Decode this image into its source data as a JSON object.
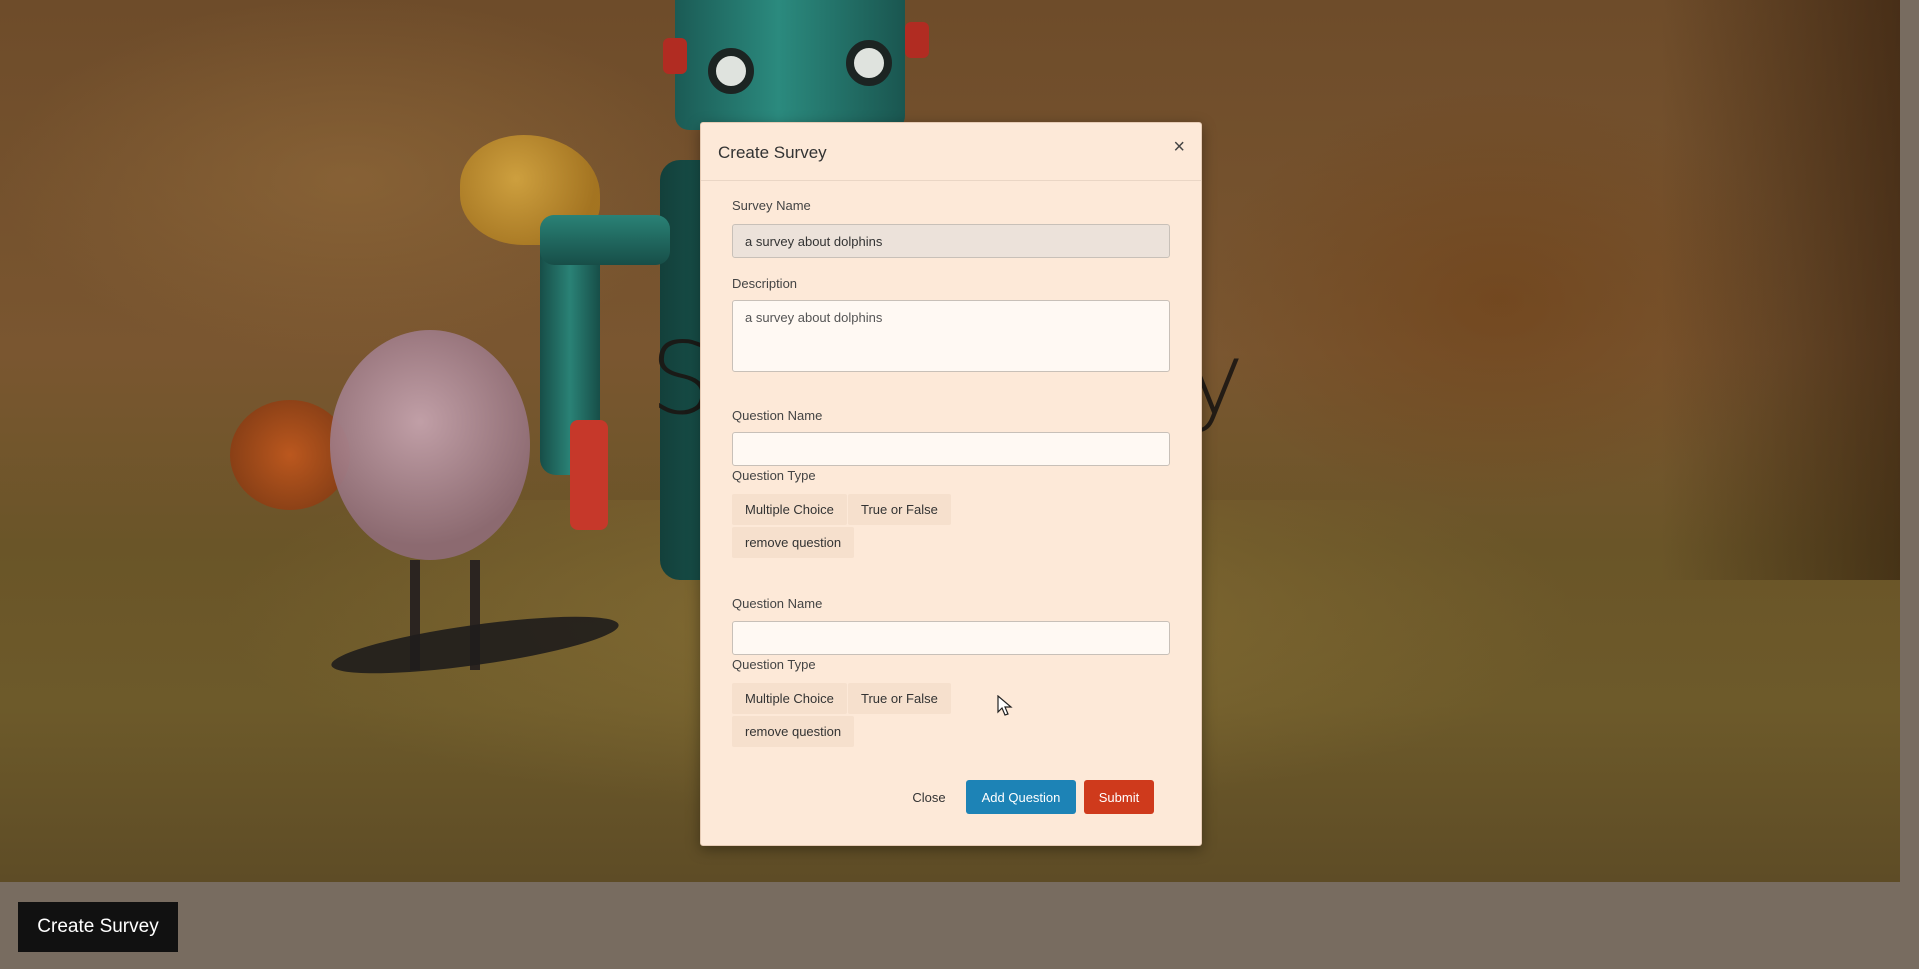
{
  "background": {
    "title_left": "S",
    "title_right": "y"
  },
  "page": {
    "create_survey_button": "Create Survey"
  },
  "modal": {
    "title": "Create Survey",
    "close_symbol": "×",
    "survey_name": {
      "label": "Survey Name",
      "value": "a survey about dolphins"
    },
    "description": {
      "label": "Description",
      "value": "a survey about dolphins"
    },
    "questions": [
      {
        "name_label": "Question Name",
        "name_value": "",
        "type_label": "Question Type",
        "type_options": [
          "Multiple Choice",
          "True or False"
        ],
        "remove_label": "remove question"
      },
      {
        "name_label": "Question Name",
        "name_value": "",
        "type_label": "Question Type",
        "type_options": [
          "Multiple Choice",
          "True or False"
        ],
        "remove_label": "remove question"
      }
    ],
    "footer": {
      "close_label": "Close",
      "add_question_label": "Add Question",
      "submit_label": "Submit"
    }
  },
  "colors": {
    "modal_bg": "#fde9d8",
    "add_question": "#1d83b6",
    "submit": "#cf3a1c",
    "create_survey_bg": "#111111"
  }
}
